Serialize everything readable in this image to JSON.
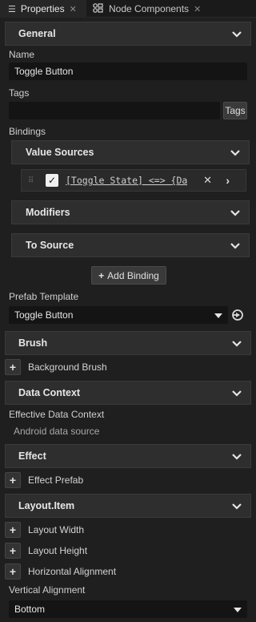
{
  "tabs": [
    {
      "label": "Properties",
      "icon": "list-icon",
      "close": "✕"
    },
    {
      "label": "Node Components",
      "icon": "components-icon",
      "close": "✕"
    }
  ],
  "sections": {
    "general": "General",
    "brush": "Brush",
    "data_context": "Data Context",
    "effect": "Effect",
    "layout_item": "Layout.Item"
  },
  "fields": {
    "name_label": "Name",
    "name_value": "Toggle Button",
    "tags_label": "Tags",
    "tags_value": "",
    "tags_button": "Tags",
    "bindings_label": "Bindings",
    "prefab_template_label": "Prefab Template",
    "prefab_template_value": "Toggle Button",
    "effective_data_context_label": "Effective Data Context",
    "effective_data_context_value": "Android data source",
    "vertical_alignment_label": "Vertical Alignment",
    "vertical_alignment_value": "Bottom"
  },
  "bindings": {
    "value_sources": "Value Sources",
    "binding_text": "[Toggle State] <=> {Da",
    "binding_checked": true,
    "modifiers": "Modifiers",
    "to_source": "To Source",
    "add_binding": "Add Binding",
    "add_binding_icon": "+"
  },
  "add_items": {
    "background_brush": "Background Brush",
    "effect_prefab": "Effect Prefab",
    "layout_width": "Layout Width",
    "layout_height": "Layout Height",
    "horizontal_alignment": "Horizontal Alignment"
  },
  "glyphs": {
    "plus": "+",
    "check": "✓",
    "remove": "✕",
    "navigate": "›",
    "drag": "⠿"
  }
}
